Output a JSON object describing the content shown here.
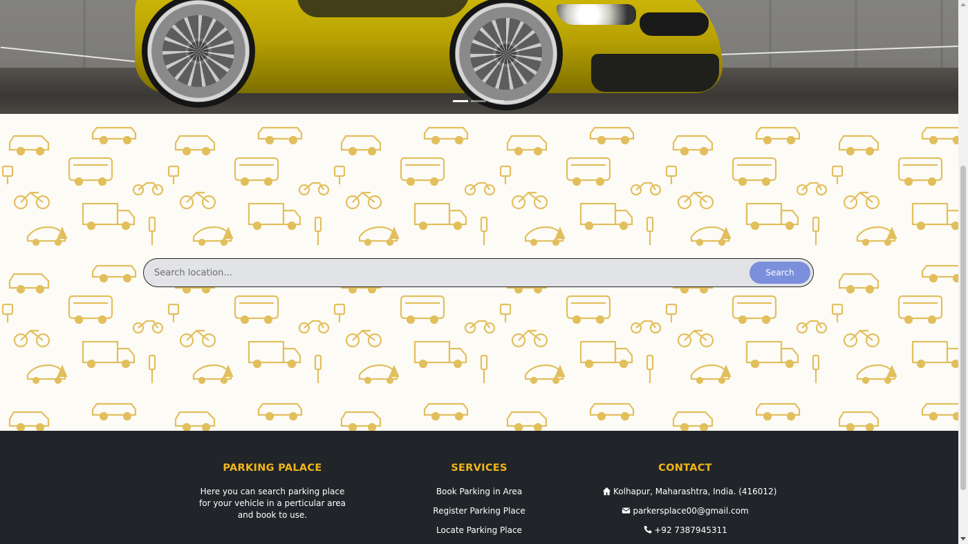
{
  "hero": {
    "image_alt": "Yellow sports car parked in front of a concrete wall",
    "slides": [
      {
        "state": "active"
      },
      {
        "state": "inactive"
      },
      {
        "state": "inactive"
      }
    ]
  },
  "search": {
    "placeholder": "Search location...",
    "button_label": "Search"
  },
  "footer": {
    "about": {
      "title": "PARKING PALACE",
      "text": "Here you can search parking place for your vehicle in a perticular area and book to use."
    },
    "services": {
      "title": "SERVICES",
      "items": [
        "Book Parking in Area",
        "Register Parking Place",
        "Locate Parking Place"
      ]
    },
    "contact": {
      "title": "CONTACT",
      "address": "Kolhapur, Maharashtra, India. (416012)",
      "email": "parkersplace00@gmail.com",
      "phone": "+92 7387945311",
      "icons": [
        "home-icon",
        "envelope-icon",
        "phone-icon"
      ]
    }
  },
  "colors": {
    "accent": "#f0b61c",
    "footer_bg": "#212529",
    "search_button": "#7b8fdc",
    "pattern": "#e2bf5d"
  }
}
